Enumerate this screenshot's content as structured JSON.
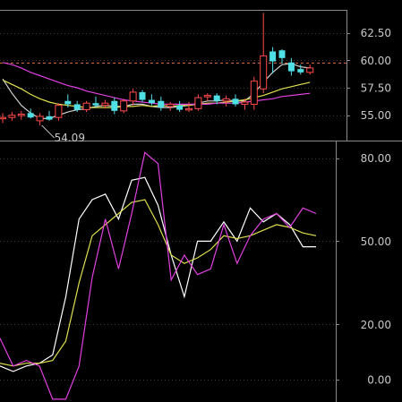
{
  "chart_data": [
    {
      "type": "candlestick",
      "ylim": [
        52.7,
        64.5
      ],
      "yticks": [
        "62.50",
        "60.00",
        "57.50",
        "55.00"
      ],
      "ytick_values": [
        62.5,
        60.0,
        57.5,
        55.0
      ],
      "reference_line": 59.75,
      "annotation": {
        "label": "54.09",
        "value": 54.09,
        "bar_index": 4
      },
      "candles": [
        {
          "o": 54.8,
          "h": 55.2,
          "l": 54.3,
          "c": 54.8,
          "up": true
        },
        {
          "o": 54.8,
          "h": 55.3,
          "l": 54.5,
          "c": 55.0,
          "up": true
        },
        {
          "o": 55.0,
          "h": 55.4,
          "l": 54.6,
          "c": 55.1,
          "up": true
        },
        {
          "o": 55.2,
          "h": 55.6,
          "l": 54.7,
          "c": 54.8,
          "up": false
        },
        {
          "o": 54.5,
          "h": 55.2,
          "l": 54.09,
          "c": 54.9,
          "up": true
        },
        {
          "o": 54.9,
          "h": 55.4,
          "l": 54.5,
          "c": 54.6,
          "up": false
        },
        {
          "o": 54.8,
          "h": 56.1,
          "l": 54.5,
          "c": 55.9,
          "up": true
        },
        {
          "o": 56.3,
          "h": 56.9,
          "l": 55.7,
          "c": 56.0,
          "up": false
        },
        {
          "o": 56.0,
          "h": 56.3,
          "l": 55.3,
          "c": 55.5,
          "up": false
        },
        {
          "o": 55.5,
          "h": 56.3,
          "l": 55.3,
          "c": 56.1,
          "up": true
        },
        {
          "o": 56.1,
          "h": 56.7,
          "l": 55.7,
          "c": 55.9,
          "up": false
        },
        {
          "o": 55.9,
          "h": 56.4,
          "l": 55.6,
          "c": 56.1,
          "up": true
        },
        {
          "o": 56.3,
          "h": 56.6,
          "l": 55.1,
          "c": 55.4,
          "up": false
        },
        {
          "o": 55.4,
          "h": 56.5,
          "l": 55.2,
          "c": 56.3,
          "up": true
        },
        {
          "o": 56.3,
          "h": 57.4,
          "l": 55.9,
          "c": 57.1,
          "up": true
        },
        {
          "o": 57.1,
          "h": 57.3,
          "l": 56.2,
          "c": 56.4,
          "up": false
        },
        {
          "o": 56.4,
          "h": 56.9,
          "l": 55.9,
          "c": 56.1,
          "up": false
        },
        {
          "o": 56.3,
          "h": 56.7,
          "l": 55.4,
          "c": 55.7,
          "up": false
        },
        {
          "o": 55.8,
          "h": 56.2,
          "l": 55.4,
          "c": 56.0,
          "up": true
        },
        {
          "o": 55.9,
          "h": 56.3,
          "l": 55.3,
          "c": 55.5,
          "up": false
        },
        {
          "o": 55.5,
          "h": 56.2,
          "l": 55.3,
          "c": 55.6,
          "up": true
        },
        {
          "o": 55.6,
          "h": 56.9,
          "l": 55.4,
          "c": 56.6,
          "up": true
        },
        {
          "o": 56.7,
          "h": 57.0,
          "l": 56.3,
          "c": 56.8,
          "up": true
        },
        {
          "o": 56.8,
          "h": 57.0,
          "l": 56.0,
          "c": 56.3,
          "up": false
        },
        {
          "o": 56.3,
          "h": 56.8,
          "l": 55.8,
          "c": 56.5,
          "up": true
        },
        {
          "o": 56.5,
          "h": 56.9,
          "l": 55.8,
          "c": 56.0,
          "up": false
        },
        {
          "o": 56.0,
          "h": 56.5,
          "l": 55.5,
          "c": 56.2,
          "up": true
        },
        {
          "o": 56.0,
          "h": 58.5,
          "l": 55.5,
          "c": 58.1,
          "up": true
        },
        {
          "o": 57.4,
          "h": 64.3,
          "l": 57.0,
          "c": 60.4,
          "up": true
        },
        {
          "o": 60.8,
          "h": 61.2,
          "l": 58.8,
          "c": 59.9,
          "up": false
        },
        {
          "o": 60.9,
          "h": 61.0,
          "l": 59.7,
          "c": 60.2,
          "up": false
        },
        {
          "o": 59.8,
          "h": 60.2,
          "l": 58.6,
          "c": 59.0,
          "up": false
        },
        {
          "o": 59.2,
          "h": 59.6,
          "l": 58.7,
          "c": 58.9,
          "up": false
        },
        {
          "o": 58.9,
          "h": 59.6,
          "l": 58.7,
          "c": 59.3,
          "up": true
        }
      ],
      "series": [
        {
          "color": "#d0d0d0",
          "values": [
            58.3,
            57.0,
            55.9,
            55.2,
            54.7,
            54.7,
            55.0,
            55.3,
            55.5,
            55.6,
            55.8,
            55.9,
            55.8,
            55.8,
            56.0,
            56.0,
            55.8,
            55.7,
            55.7,
            55.8,
            55.9,
            56.1,
            56.3,
            56.3,
            56.4,
            56.3,
            56.3,
            57.0,
            58.0,
            58.9,
            59.6,
            59.7,
            59.4,
            59.3
          ]
        },
        {
          "color": "#e0e050",
          "values": [
            58.2,
            57.8,
            57.4,
            56.9,
            56.5,
            56.2,
            56.0,
            55.9,
            55.8,
            55.7,
            55.7,
            55.7,
            55.7,
            55.8,
            55.8,
            55.9,
            55.8,
            55.9,
            55.8,
            55.9,
            55.9,
            56.0,
            56.1,
            56.1,
            56.2,
            56.3,
            56.4,
            56.6,
            56.8,
            57.1,
            57.4,
            57.6,
            57.8,
            58.0
          ]
        },
        {
          "color": "#e040e0",
          "values": [
            59.8,
            59.6,
            59.3,
            58.9,
            58.6,
            58.3,
            58.0,
            57.7,
            57.5,
            57.2,
            57.0,
            56.8,
            56.6,
            56.4,
            56.3,
            56.2,
            56.1,
            56.0,
            56.0,
            56.0,
            56.0,
            56.0,
            56.0,
            56.1,
            56.1,
            56.1,
            56.2,
            56.3,
            56.4,
            56.5,
            56.7,
            56.8,
            56.9,
            57.0
          ]
        }
      ]
    },
    {
      "type": "line",
      "ylim": [
        -8,
        86
      ],
      "yticks": [
        "80.00",
        "50.00",
        "20.00",
        "0.00"
      ],
      "ytick_values": [
        80,
        50,
        20,
        0
      ],
      "series": [
        {
          "color": "#ffffff",
          "values": [
            5,
            3,
            5,
            6,
            9,
            30,
            58,
            65,
            67,
            58,
            72,
            73,
            63,
            45,
            30,
            50,
            50,
            57,
            50,
            62,
            57,
            60,
            56,
            48,
            48
          ]
        },
        {
          "color": "#e0e050",
          "values": [
            6,
            5,
            6,
            6,
            7,
            14,
            35,
            52,
            56,
            60,
            64,
            65,
            56,
            45,
            42,
            44,
            47,
            52,
            51,
            52,
            54,
            56,
            55,
            53,
            52
          ]
        },
        {
          "color": "#e040e0",
          "values": [
            15,
            5,
            7,
            5,
            -7,
            -7,
            5,
            37,
            58,
            40,
            60,
            82,
            78,
            36,
            45,
            38,
            40,
            56,
            42,
            52,
            58,
            60,
            55,
            62,
            60
          ]
        }
      ]
    }
  ]
}
